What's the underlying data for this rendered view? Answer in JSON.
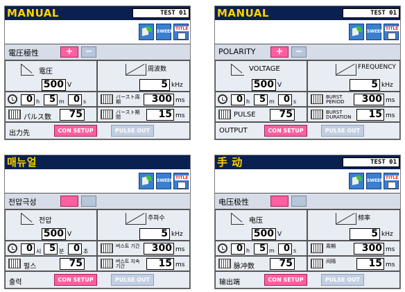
{
  "panels": [
    {
      "title": "MANUAL",
      "test_label": "TEST 01",
      "sweep_label": "SWEEP",
      "title_btn_label": "TITLE",
      "polarity_label": "電圧極性",
      "plus": "+",
      "minus": "−",
      "voltage_label": "電圧",
      "voltage_value": "500",
      "voltage_unit": "V",
      "frequency_label": "周波数",
      "frequency_value": "5",
      "frequency_unit": "kHz",
      "time_h": "0",
      "time_h_unit": "h",
      "time_m": "5",
      "time_m_unit": "m",
      "time_s": "0",
      "time_s_unit": "s",
      "period_label": "バースト周期",
      "period_value": "300",
      "period_unit": "ms",
      "pulse_label": "パルス数",
      "pulse_value": "75",
      "duration_label": "バースト期間",
      "duration_value": "15",
      "duration_unit": "ms",
      "output_label": "出力先",
      "con_setup": "CON SETUP",
      "pulse_out": "PULSE OUT"
    },
    {
      "title": "MANUAL",
      "test_label": "TEST 01",
      "sweep_label": "SWEEP",
      "title_btn_label": "TITLE",
      "polarity_label": "POLARITY",
      "plus": "+",
      "minus": "−",
      "voltage_label": "VOLTAGE",
      "voltage_value": "500",
      "voltage_unit": "V",
      "frequency_label": "FREQUENCY",
      "frequency_value": "5",
      "frequency_unit": "kHz",
      "time_h": "0",
      "time_h_unit": "h",
      "time_m": "5",
      "time_m_unit": "m",
      "time_s": "0",
      "time_s_unit": "s",
      "period_label": "BURST PERIOD",
      "period_value": "300",
      "period_unit": "ms",
      "pulse_label": "PULSE",
      "pulse_value": "75",
      "duration_label": "BURST DURATION",
      "duration_value": "15",
      "duration_unit": "ms",
      "output_label": "OUTPUT",
      "con_setup": "CON SETUP",
      "pulse_out": "PULSE OUT"
    },
    {
      "title": "매뉴얼",
      "test_label": "",
      "sweep_label": "SWEEP",
      "title_btn_label": "TITLE",
      "polarity_label": "전압극성",
      "plus": "",
      "minus": "",
      "voltage_label": "전압",
      "voltage_value": "500",
      "voltage_unit": "V",
      "frequency_label": "주파수",
      "frequency_value": "5",
      "frequency_unit": "kHz",
      "time_h": "0",
      "time_h_unit": "시",
      "time_m": "5",
      "time_m_unit": "분",
      "time_s": "0",
      "time_s_unit": "초",
      "period_label": "버스트 기간",
      "period_value": "300",
      "period_unit": "ms",
      "pulse_label": "펄스",
      "pulse_value": "75",
      "duration_label": "버스트 지속기간",
      "duration_value": "15",
      "duration_unit": "ms",
      "output_label": "출력",
      "con_setup": "CON SETUP",
      "pulse_out": "PULSE OUT"
    },
    {
      "title": "手 动",
      "test_label": "TEST 01",
      "sweep_label": "SWEEP",
      "title_btn_label": "TITLE",
      "polarity_label": "电压极性",
      "plus": "",
      "minus": "",
      "voltage_label": "电压",
      "voltage_value": "500",
      "voltage_unit": "V",
      "frequency_label": "频率",
      "frequency_value": "5",
      "frequency_unit": "kHz",
      "time_h": "0",
      "time_h_unit": "h",
      "time_m": "5",
      "time_m_unit": "m",
      "time_s": "0",
      "time_s_unit": "s",
      "period_label": "周期",
      "period_value": "300",
      "period_unit": "ms",
      "pulse_label": "脉冲数",
      "pulse_value": "75",
      "duration_label": "间隔",
      "duration_value": "15",
      "duration_unit": "ms",
      "output_label": "输出端",
      "con_setup": "CON SETUP",
      "pulse_out": "PULSE OUT"
    }
  ]
}
